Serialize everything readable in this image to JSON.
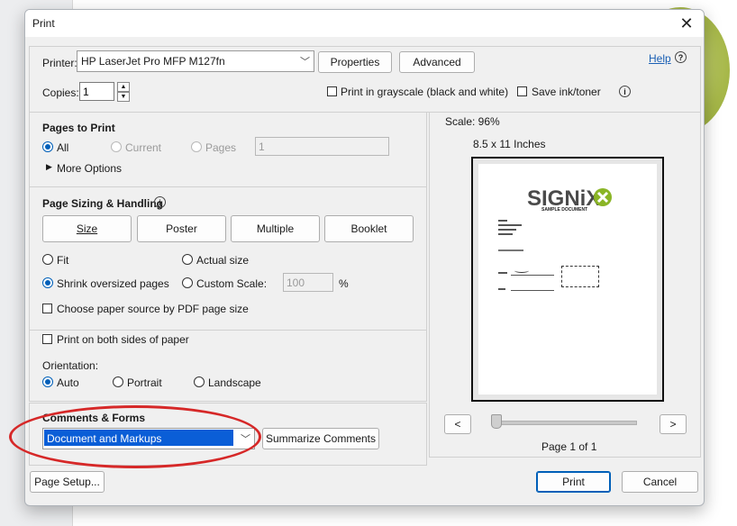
{
  "dialog": {
    "title": "Print",
    "close_glyph": "✕",
    "help_label": "Help"
  },
  "printer": {
    "label": "Printer:",
    "value": "HP LaserJet Pro MFP M127fn",
    "properties_label": "Properties",
    "advanced_label": "Advanced",
    "copies_label": "Copies:",
    "copies_value": "1",
    "grayscale_label": "Print in grayscale (black and white)",
    "save_ink_label": "Save ink/toner"
  },
  "pages_to_print": {
    "heading": "Pages to Print",
    "all_label": "All",
    "current_label": "Current",
    "pages_label": "Pages",
    "pages_value": "1",
    "more_options_label": "More Options"
  },
  "sizing": {
    "heading": "Page Sizing & Handling",
    "tabs": [
      "Size",
      "Poster",
      "Multiple",
      "Booklet"
    ],
    "fit_label": "Fit",
    "actual_size_label": "Actual size",
    "shrink_label": "Shrink oversized pages",
    "custom_scale_label": "Custom Scale:",
    "custom_scale_value": "100",
    "percent_label": "%",
    "paper_source_label": "Choose paper source by PDF page size"
  },
  "duplex": {
    "both_sides_label": "Print on both sides of paper",
    "orientation_label": "Orientation:",
    "auto_label": "Auto",
    "portrait_label": "Portrait",
    "landscape_label": "Landscape"
  },
  "comments": {
    "heading": "Comments & Forms",
    "value": "Document and Markups",
    "summarize_label": "Summarize Comments"
  },
  "preview": {
    "scale_label": "Scale:  96%",
    "paper_size": "8.5 x 11 Inches",
    "logo_text": "SIGNiX",
    "doc_subtitle": "SAMPLE DOCUMENT",
    "prev_glyph": "<",
    "next_glyph": ">",
    "page_indicator": "Page 1 of 1"
  },
  "footer": {
    "page_setup_label": "Page Setup...",
    "print_label": "Print",
    "cancel_label": "Cancel"
  },
  "colors": {
    "accent": "#005fb8",
    "annotation": "#d62828",
    "brand_green": "#8ab526"
  }
}
